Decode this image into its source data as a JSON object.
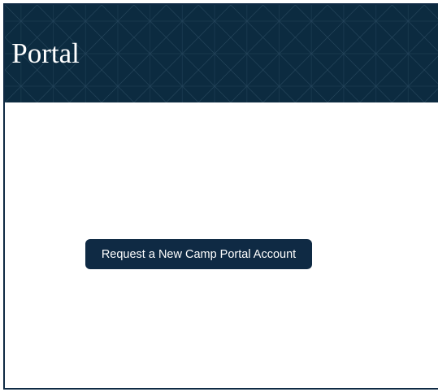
{
  "header": {
    "title": "p Portal"
  },
  "main": {
    "request_button_label": "Request a New Camp Portal Account"
  },
  "colors": {
    "header_background": "#0c2b40",
    "button_background": "#0f2a44",
    "frame_border": "#0f2a44"
  }
}
